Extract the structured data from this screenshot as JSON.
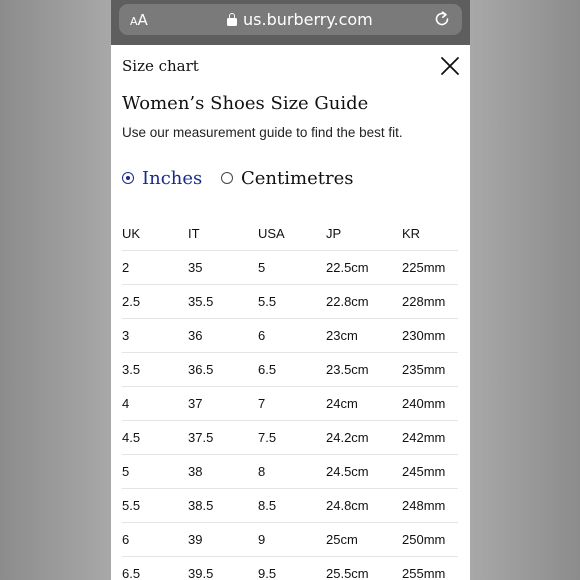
{
  "browser": {
    "aa_small": "A",
    "aa_large": "A",
    "domain": "us.burberry.com"
  },
  "sheet": {
    "title": "Size chart",
    "guide_title": "Women’s Shoes Size Guide",
    "subtitle": "Use our measurement guide to find the best fit.",
    "units": [
      {
        "label": "Inches",
        "selected": true
      },
      {
        "label": "Centimetres",
        "selected": false
      }
    ],
    "accent_color": "#1a2a8c"
  },
  "table": {
    "headers": [
      "UK",
      "IT",
      "USA",
      "JP",
      "KR"
    ],
    "rows": [
      [
        "2",
        "35",
        "5",
        "22.5cm",
        "225mm"
      ],
      [
        "2.5",
        "35.5",
        "5.5",
        "22.8cm",
        "228mm"
      ],
      [
        "3",
        "36",
        "6",
        "23cm",
        "230mm"
      ],
      [
        "3.5",
        "36.5",
        "6.5",
        "23.5cm",
        "235mm"
      ],
      [
        "4",
        "37",
        "7",
        "24cm",
        "240mm"
      ],
      [
        "4.5",
        "37.5",
        "7.5",
        "24.2cm",
        "242mm"
      ],
      [
        "5",
        "38",
        "8",
        "24.5cm",
        "245mm"
      ],
      [
        "5.5",
        "38.5",
        "8.5",
        "24.8cm",
        "248mm"
      ],
      [
        "6",
        "39",
        "9",
        "25cm",
        "250mm"
      ],
      [
        "6.5",
        "39.5",
        "9.5",
        "25.5cm",
        "255mm"
      ]
    ]
  }
}
